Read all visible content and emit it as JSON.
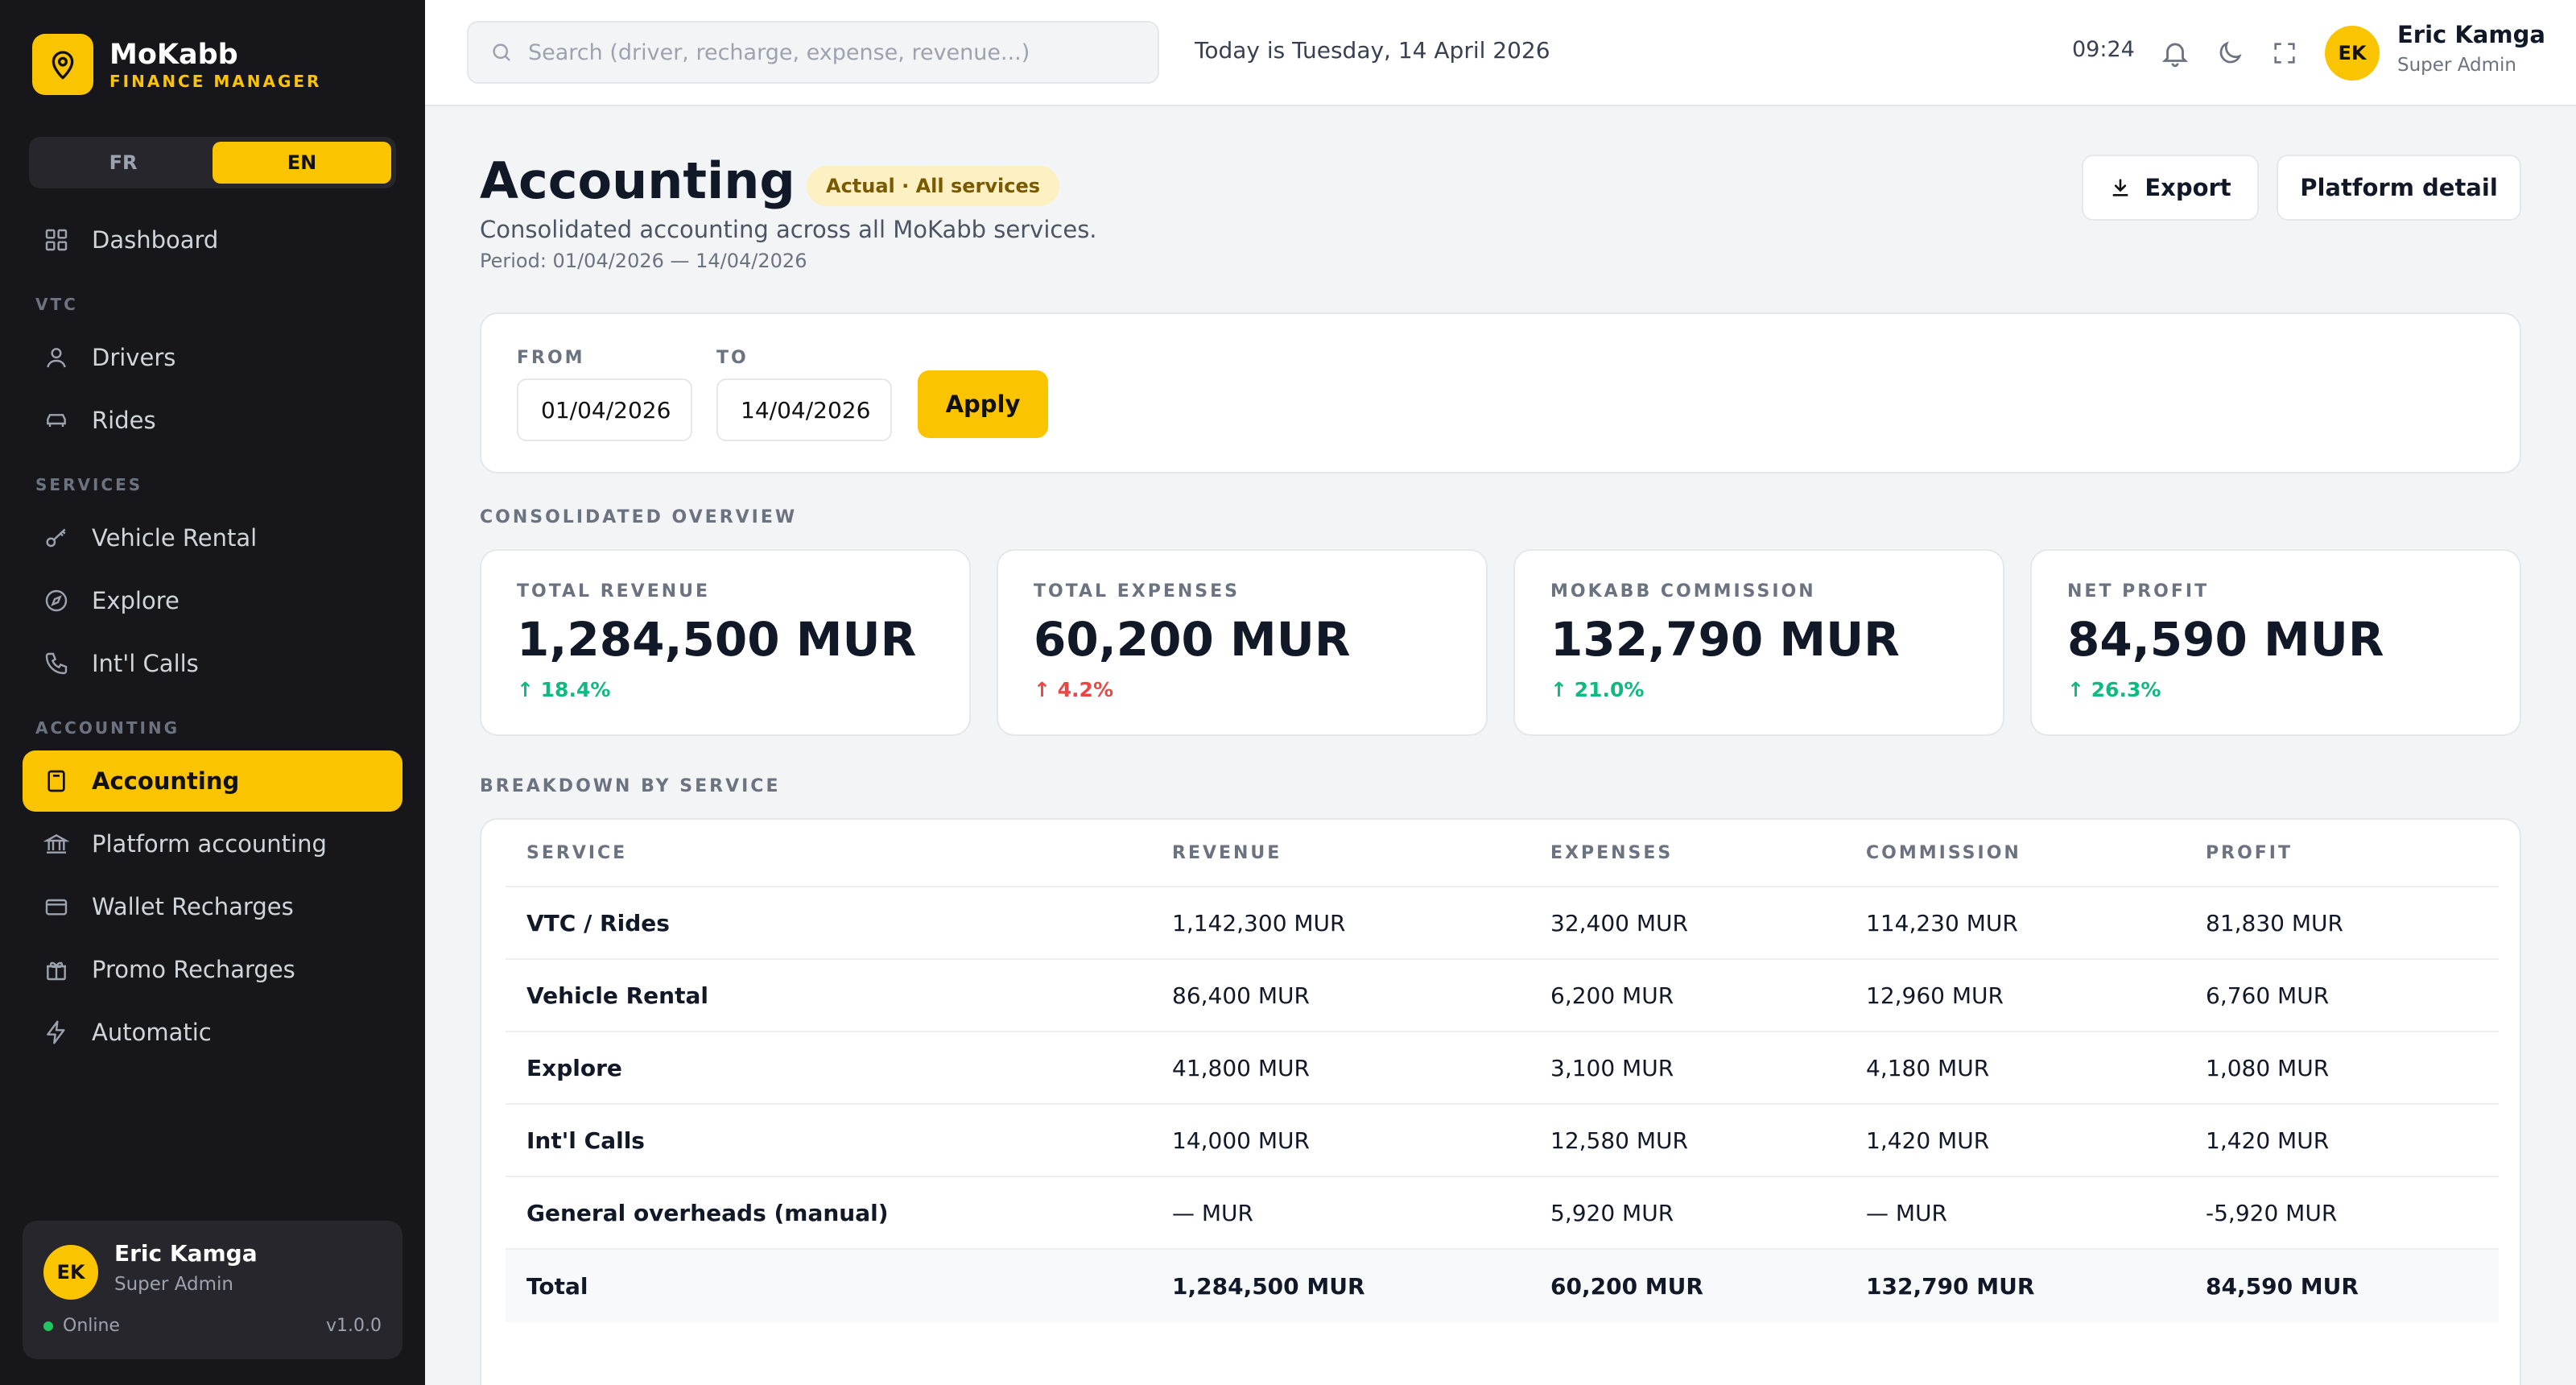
{
  "brand": {
    "name": "MoKabb",
    "subtitle": "FINANCE MANAGER",
    "logo_icon": "map-pin-icon"
  },
  "language": {
    "options": [
      "FR",
      "EN"
    ],
    "selected": "EN"
  },
  "sidebar": {
    "items": [
      {
        "label": "Dashboard",
        "icon": "grid-icon"
      },
      {
        "section": "VTC"
      },
      {
        "label": "Drivers",
        "icon": "user-icon"
      },
      {
        "label": "Rides",
        "icon": "car-icon"
      },
      {
        "section": "SERVICES"
      },
      {
        "label": "Vehicle Rental",
        "icon": "key-icon"
      },
      {
        "label": "Explore",
        "icon": "compass-icon"
      },
      {
        "label": "Int'l Calls",
        "icon": "phone-icon"
      },
      {
        "section": "ACCOUNTING"
      },
      {
        "label": "Accounting",
        "icon": "calculator-icon",
        "active": true
      },
      {
        "label": "Platform accounting",
        "icon": "bank-icon"
      },
      {
        "label": "Wallet Recharges",
        "icon": "credit-card-icon"
      },
      {
        "label": "Promo Recharges",
        "icon": "gift-icon"
      },
      {
        "label": "Automatic",
        "icon": "lightning-icon"
      }
    ],
    "user": {
      "initials": "EK",
      "name": "Eric Kamga",
      "role": "Super Admin",
      "status": "Online",
      "version": "v1.0.0"
    }
  },
  "header": {
    "search_placeholder": "Search (driver, recharge, expense, revenue...)",
    "today": "Today is Tuesday, 14 April 2026",
    "time": "09:24",
    "user": {
      "initials": "EK",
      "name": "Eric Kamga",
      "role": "Super Admin"
    }
  },
  "page": {
    "title": "Accounting",
    "badge": "Actual · All services",
    "subtitle": "Consolidated accounting across all MoKabb services.",
    "period": "Period: 01/04/2026 — 14/04/2026",
    "export_label": "Export",
    "platform_label": "Platform detail"
  },
  "filter": {
    "from_label": "FROM",
    "from_value": "01/04/2026",
    "to_label": "TO",
    "to_value": "14/04/2026",
    "apply_label": "Apply"
  },
  "overview": {
    "title": "CONSOLIDATED OVERVIEW",
    "kpis": [
      {
        "label": "TOTAL REVENUE",
        "value": "1,284,500 MUR",
        "delta": "↑ 18.4%",
        "delta_color": "#10b981"
      },
      {
        "label": "TOTAL EXPENSES",
        "value": "60,200 MUR",
        "delta": "↑ 4.2%",
        "delta_color": "#ef4444"
      },
      {
        "label": "MOKABB COMMISSION",
        "value": "132,790 MUR",
        "delta": "↑ 21.0%",
        "delta_color": "#10b981"
      },
      {
        "label": "NET PROFIT",
        "value": "84,590 MUR",
        "delta": "↑ 26.3%",
        "delta_color": "#10b981"
      }
    ]
  },
  "breakdown": {
    "title": "BREAKDOWN BY SERVICE",
    "columns": [
      "SERVICE",
      "REVENUE",
      "EXPENSES",
      "COMMISSION",
      "PROFIT"
    ],
    "rows": [
      [
        "VTC / Rides",
        "1,142,300 MUR",
        "32,400 MUR",
        "114,230 MUR",
        "81,830 MUR"
      ],
      [
        "Vehicle Rental",
        "86,400 MUR",
        "6,200 MUR",
        "12,960 MUR",
        "6,760 MUR"
      ],
      [
        "Explore",
        "41,800 MUR",
        "3,100 MUR",
        "4,180 MUR",
        "1,080 MUR"
      ],
      [
        "Int'l Calls",
        "14,000 MUR",
        "12,580 MUR",
        "1,420 MUR",
        "1,420 MUR"
      ],
      [
        "General overheads (manual)",
        "— MUR",
        "5,920 MUR",
        "— MUR",
        "-5,920 MUR"
      ]
    ],
    "total": [
      "Total",
      "1,284,500 MUR",
      "60,200 MUR",
      "132,790 MUR",
      "84,590 MUR"
    ]
  },
  "colors": {
    "accent": "#fbc400",
    "sidebar_bg": "#17171b",
    "positive": "#10b981",
    "negative": "#ef4444"
  }
}
